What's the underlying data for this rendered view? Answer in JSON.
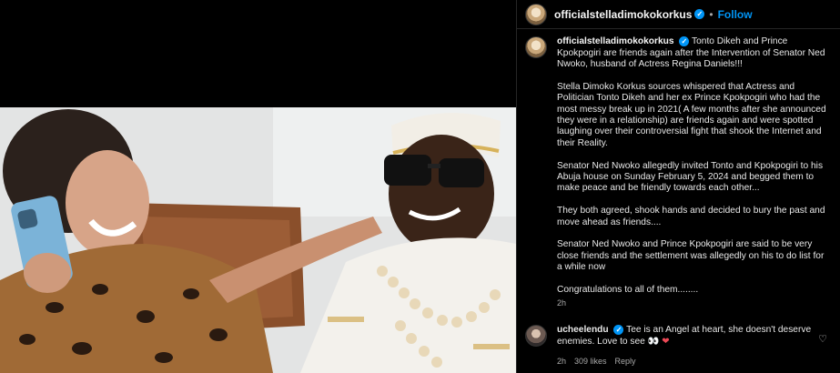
{
  "header": {
    "username": "officialstelladimokokorkus",
    "dot": "•",
    "follow_label": "Follow"
  },
  "caption": {
    "username": "officialstelladimokokorkus",
    "lead": "Tonto Dikeh and Prince Kpokpogiri are friends again after the Intervention of Senator Ned Nwoko, husband of Actress Regina Daniels!!!",
    "paragraphs": [
      "Stella Dimoko Korkus sources whispered that Actress and Politician Tonto Dikeh and her ex Prince Kpokpogiri who had the most messy break up in 2021( A few months after she announced they were in a relationship) are friends again and were spotted laughing over their controversial fight that shook the Internet and their Reality.",
      "Senator Ned Nwoko allegedly invited Tonto and Kpokpogiri to his Abuja house on Sunday February 5, 2024 and begged them to make peace and be friendly towards each other...",
      "They both agreed, shook hands and decided to bury the past and move ahead as friends....",
      "Senator Ned Nwoko and Prince Kpokpogiri are said to be very close friends and the settlement was allegedly on his to do list for a while now",
      "Congratulations to all of them........"
    ],
    "time": "2h"
  },
  "comment": {
    "username": "ucheelendu",
    "text": "Tee is an Angel at heart, she doesn't deserve enemies. Love to see",
    "emoji": "👀",
    "heart": "❤",
    "time": "2h",
    "likes": "309 likes",
    "reply_label": "Reply",
    "like_icon": "♡"
  },
  "colors": {
    "accent": "#0095f6",
    "like_red": "#ed4956",
    "background": "#000000"
  },
  "icons": [
    "verified-badge-icon",
    "heart-outline-icon",
    "red-heart-icon"
  ]
}
